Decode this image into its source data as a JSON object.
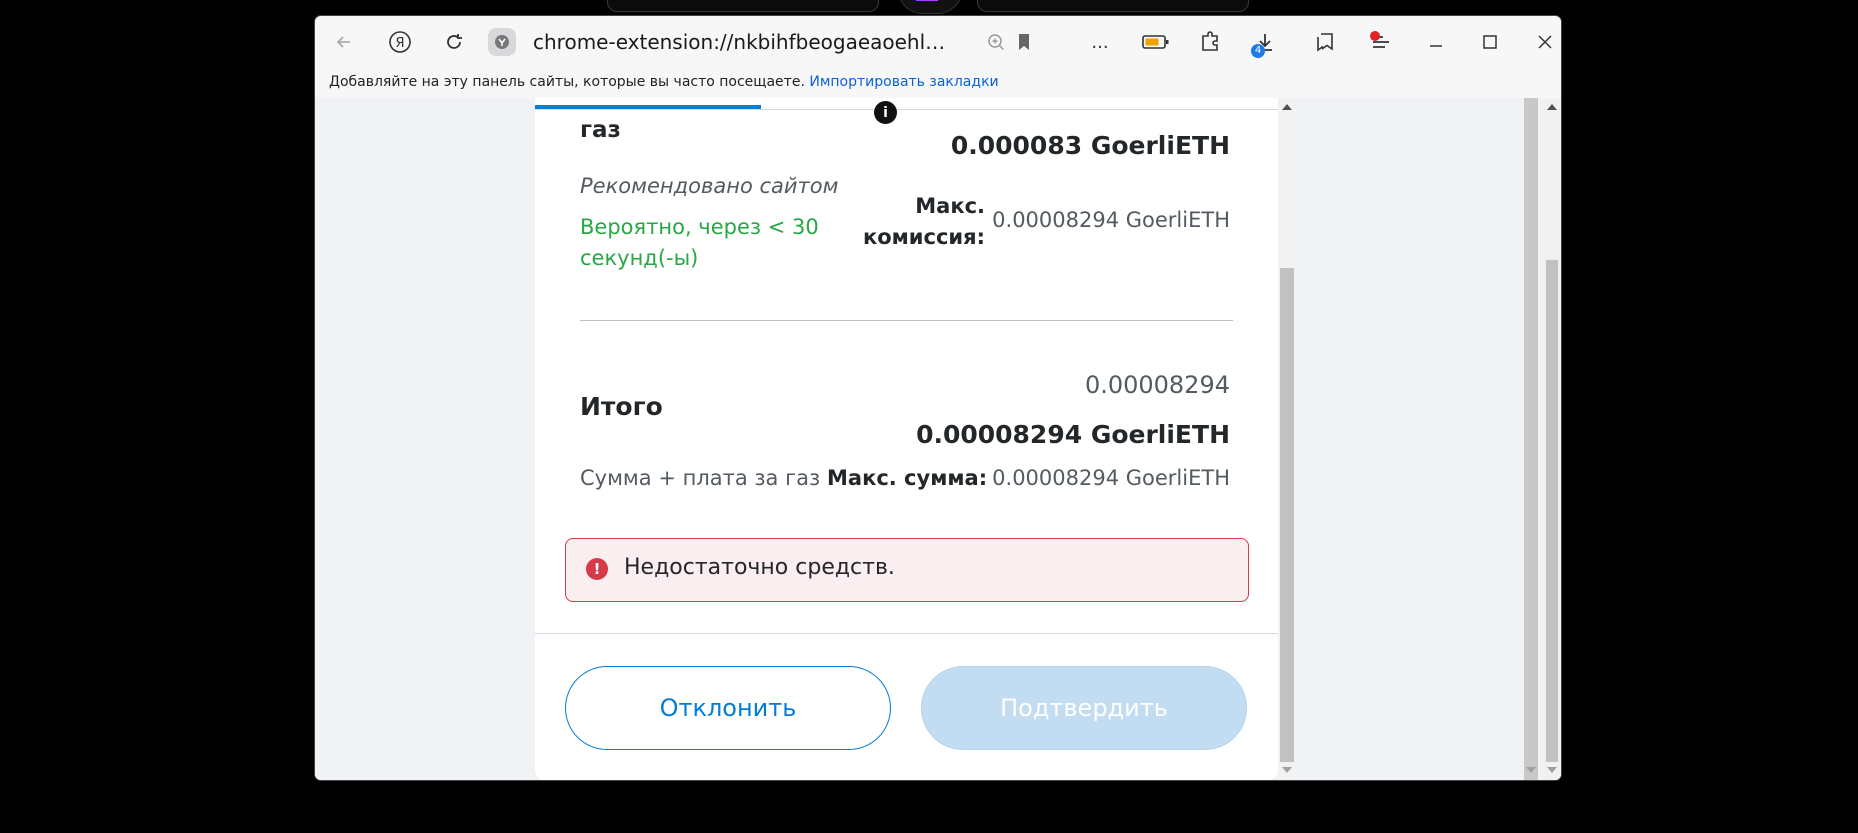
{
  "browser": {
    "url": "chrome-extension://nkbihfbeogaeaoehlefn...",
    "more_label": "...",
    "downloads_badge": "4",
    "bookmarks_bar": {
      "prompt": "Добавляйте на эту панель сайты, которые вы часто посещаете.",
      "import_link": "Импортировать закладки"
    }
  },
  "gas": {
    "label": "газ",
    "info_icon": "i",
    "amount": "0.000083 GoerliETH",
    "recommended": "Рекомендовано сайтом",
    "likely": "Вероятно, через < 30 секунд(-ы)",
    "max_fee_label": "Макс. комиссия:",
    "max_fee_value": "0.00008294 GoerliETH"
  },
  "total": {
    "amount_small": "0.00008294",
    "label": "Итого",
    "amount": "0.00008294 GoerliETH",
    "note": "Сумма + плата за газ",
    "max_sum_label": "Макс. сумма:",
    "max_sum_value": "0.00008294 GoerliETH"
  },
  "error": {
    "icon": "!",
    "message": "Недостаточно средств."
  },
  "buttons": {
    "reject": "Отклонить",
    "confirm": "Подтвердить"
  },
  "colors": {
    "accent": "#037dd6",
    "success": "#28a745",
    "error": "#d73a49",
    "confirm_disabled": "#c2dcf1"
  }
}
